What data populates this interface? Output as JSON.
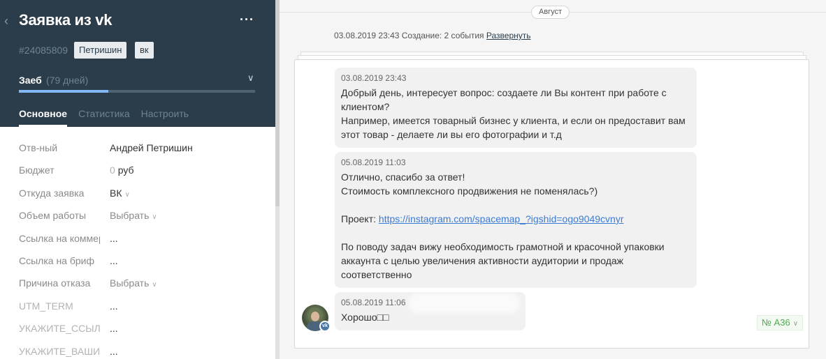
{
  "lead": {
    "title": "Заявка из vk",
    "id": "#24085809",
    "tags": [
      "Петришин",
      "вк"
    ],
    "stage": {
      "name": "Заеб",
      "days": "(79 дней)",
      "progress": 0.38
    },
    "tabs": [
      "Основное",
      "Статистика",
      "Настроить"
    ]
  },
  "fields": [
    {
      "label": "Отв-ный",
      "value": "Андрей Петришин"
    },
    {
      "label": "Бюджет",
      "zero": "0",
      "value": "руб"
    },
    {
      "label": "Откуда заявка",
      "value": "ВК"
    },
    {
      "label": "Объем работы",
      "value": "Выбрать"
    },
    {
      "label": "Ссылка на коммерческое",
      "value": "..."
    },
    {
      "label": "Ссылка на бриф",
      "value": "..."
    },
    {
      "label": "Причина отказа",
      "value": "Выбрать"
    },
    {
      "label": "UTM_TERM",
      "value": "..."
    },
    {
      "label": "УКАЖИТЕ_ССЫЛКУ",
      "value": "..."
    },
    {
      "label": "УКАЖИТЕ_ВАШИ_",
      "value": "..."
    }
  ],
  "feed": {
    "month": "Август",
    "event_summary": "03.08.2019 23:43 Создание: 2 события",
    "expand_link": "Развернуть",
    "messages": [
      {
        "time": "03.08.2019 23:43",
        "lines": [
          "Добрый день, интересует вопрос: создаете ли Вы контент при работе с",
          "клиентом?",
          "Например, имеется товарный бизнес у клиента, и если он предоставит вам",
          "этот товар - делаете ли вы его фотографии и т.д"
        ]
      },
      {
        "time": "05.08.2019 11:03",
        "lines": [
          "Отлично, спасибо за ответ!",
          "Стоимость комплексного продвижения не поменялась?)",
          "",
          "Проект: ",
          "",
          "По поводу задач вижу необходимость грамотной и красочной упаковки",
          "аккаунта с целью увеличения активности аудитории и продаж",
          "соответственно"
        ],
        "link": "https://instagram.com/spacemap_?igshid=ogo9049cvnyr"
      },
      {
        "time": "05.08.2019 11:06",
        "lines": [
          "Хорошо□□"
        ]
      }
    ],
    "talk_badge": "№ А36",
    "avatar_badge": "vk"
  }
}
